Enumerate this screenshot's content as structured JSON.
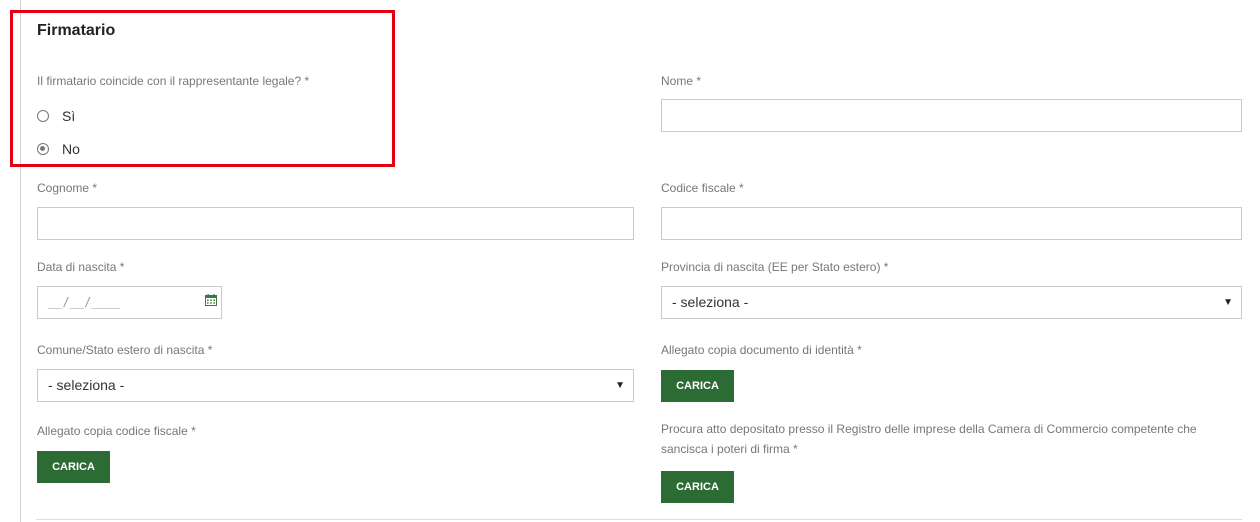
{
  "section": {
    "title": "Firmatario"
  },
  "question": {
    "label": "Il firmatario coincide con il rappresentante legale? *",
    "options": [
      {
        "label": "Sì",
        "checked": false
      },
      {
        "label": "No",
        "checked": true
      }
    ]
  },
  "fields": {
    "nome": {
      "label": "Nome *",
      "value": ""
    },
    "cognome": {
      "label": "Cognome *",
      "value": ""
    },
    "codice_fiscale": {
      "label": "Codice fiscale *",
      "value": ""
    },
    "data_nascita": {
      "label": "Data di nascita *",
      "placeholder": "__/__/____"
    },
    "provincia_nascita": {
      "label": "Provincia di nascita (EE per Stato estero) *",
      "selected": "- seleziona -"
    },
    "comune_nascita": {
      "label": "Comune/Stato estero di nascita *",
      "selected": "- seleziona -"
    },
    "allegato_identita": {
      "label": "Allegato copia documento di identità *",
      "button": "CARICA"
    },
    "allegato_codice_fiscale": {
      "label": "Allegato copia codice fiscale *",
      "button": "CARICA"
    },
    "procura": {
      "label": "Procura atto depositato presso il Registro delle imprese della Camera di Commercio competente che sancisca i poteri di firma *",
      "button": "CARICA"
    }
  },
  "icons": {
    "calendar": "calendar-icon",
    "dropdown": "▼"
  },
  "colors": {
    "button_bg": "#2d6b34",
    "highlight_border": "#e3000f",
    "calendar_green": "#3b7a3f"
  }
}
